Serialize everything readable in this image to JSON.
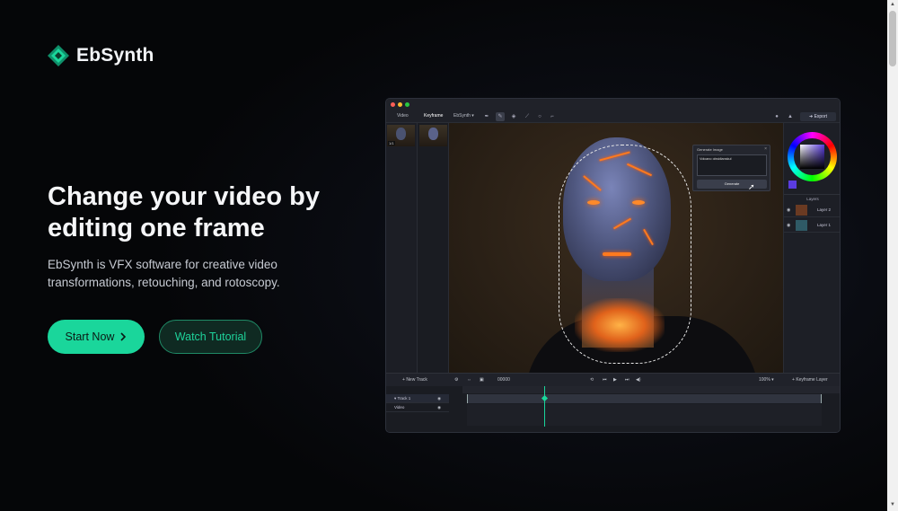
{
  "brand": {
    "name": "EbSynth",
    "accent": "#1ad69b"
  },
  "hero": {
    "title": "Change your video by editing one frame",
    "subtitle": "EbSynth is VFX software for creative video transformations, retouching, and rotoscopy.",
    "primary_button": "Start Now",
    "secondary_button": "Watch Tutorial"
  },
  "app": {
    "tabs": [
      "Video",
      "Keyframe"
    ],
    "mode_dropdown": "EbSynth",
    "export_label": "Export",
    "video_thumb_label": "1/1",
    "generate_panel": {
      "title": "Generate Image",
      "prompt": "Volcano obsidianskul",
      "button": "Generate"
    },
    "layers": {
      "title": "Layers",
      "items": [
        "Layer 2",
        "Layer 1"
      ]
    },
    "controls": {
      "new_track": "New Track",
      "frame": "00000",
      "zoom": "100%",
      "keyframe_layer": "Keyframe Layer"
    },
    "tracks": [
      "Track 1",
      "Video"
    ]
  },
  "icons": {
    "logo": "ebsynth-diamond-icon",
    "chevron": "chevron-right-icon"
  }
}
